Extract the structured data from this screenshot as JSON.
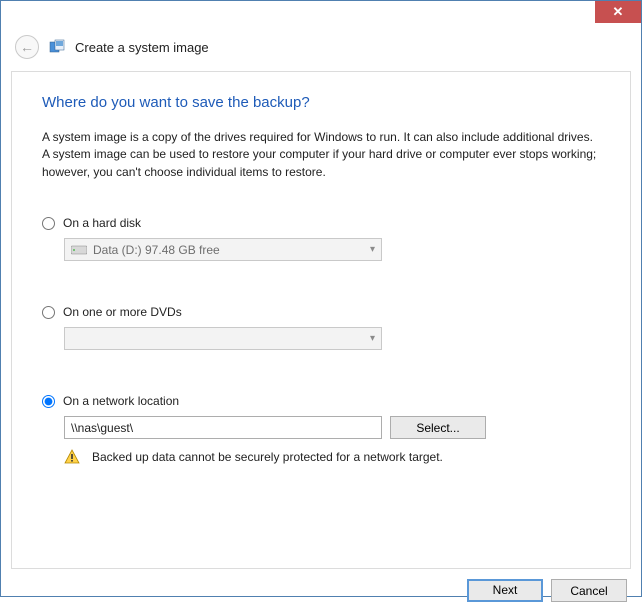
{
  "window": {
    "title": "Create a system image"
  },
  "page": {
    "heading": "Where do you want to save the backup?",
    "description": "A system image is a copy of the drives required for Windows to run. It can also include additional drives. A system image can be used to restore your computer if your hard drive or computer ever stops working; however, you can't choose individual items to restore."
  },
  "options": {
    "hard_disk": {
      "label": "On a hard disk",
      "selected": false,
      "combo_value": "Data (D:)  97.48 GB free"
    },
    "dvd": {
      "label": "On one or more DVDs",
      "selected": false,
      "combo_value": ""
    },
    "network": {
      "label": "On a network location",
      "selected": true,
      "path": "\\\\nas\\guest\\",
      "select_button": "Select...",
      "warning": "Backed up data cannot be securely protected for a network target."
    }
  },
  "footer": {
    "next": "Next",
    "cancel": "Cancel"
  }
}
